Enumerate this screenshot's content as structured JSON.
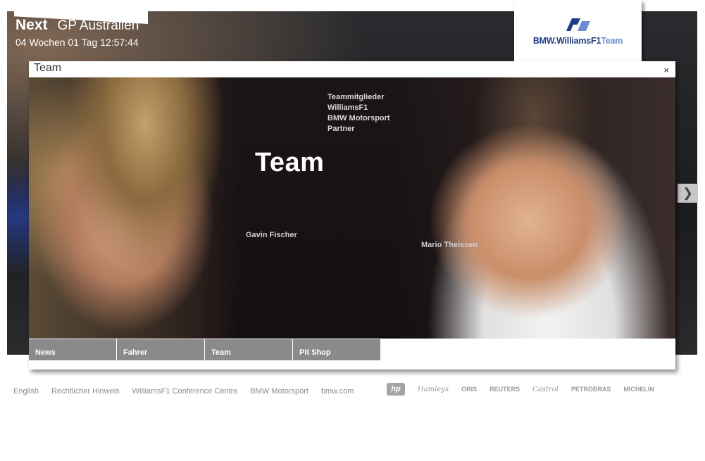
{
  "header": {
    "next_label": "Next",
    "next_race": "GP Australien",
    "countdown": "04 Wochen 01 Tag 12:57:44"
  },
  "logo": {
    "text_bold": "BMW.WilliamsF1",
    "text_light": "Team",
    "colors": {
      "primary": "#1e3d8c",
      "secondary": "#6b8fd6"
    }
  },
  "modal": {
    "title": "Team",
    "close": "×",
    "heading": "Team",
    "submenu": [
      "Teammitglieder",
      "WilliamsF1",
      "BMW Motorsport",
      "Partner"
    ],
    "person_left": "Gavin Fischer",
    "person_right": "Mario Theissen",
    "nav": [
      "News",
      "Fahrer",
      "Team",
      "Pit Shop"
    ]
  },
  "footer": {
    "links": [
      "English",
      "Rechtlicher Hinweis",
      "WilliamsF1 Conference Centre",
      "BMW Motorsport",
      "bmw.com"
    ],
    "sponsors": [
      "hp",
      "Hamleys",
      "ORIS",
      "REUTERS",
      "Castrol",
      "PETROBRAS",
      "MICHELIN"
    ]
  },
  "icons": {
    "arrow": "chevron-right-icon",
    "close": "close-icon"
  }
}
